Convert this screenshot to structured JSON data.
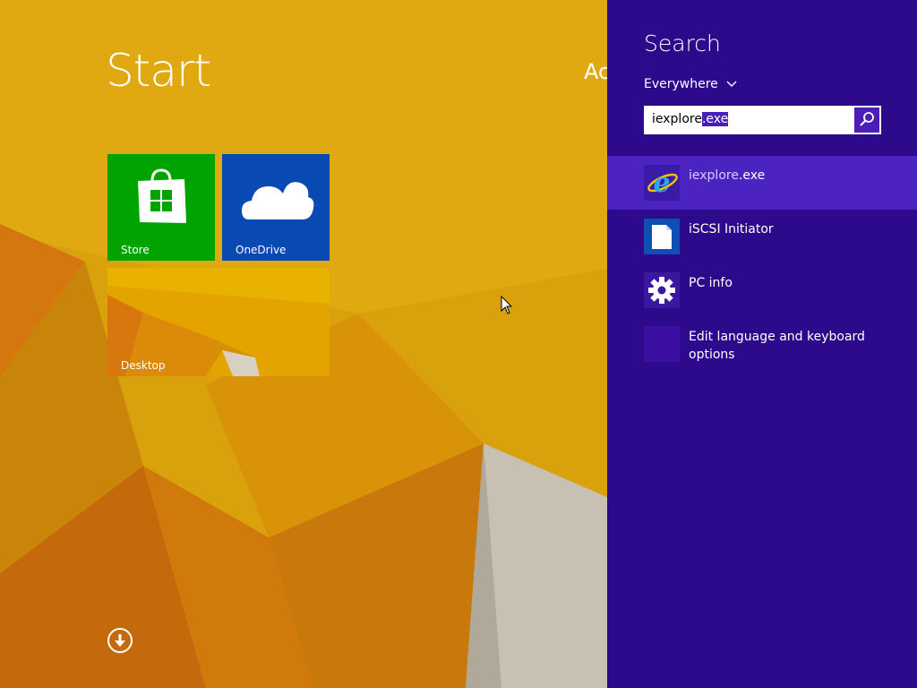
{
  "start": {
    "title": "Start",
    "account_peek": "Ac",
    "tiles": [
      {
        "label": "Store",
        "color": "#00a300",
        "icon": "store-bag-icon"
      },
      {
        "label": "OneDrive",
        "color": "#094ab2",
        "icon": "cloud-icon"
      },
      {
        "label": "Desktop",
        "color": "#e3a400",
        "icon": "desktop-wallpaper"
      }
    ],
    "apps_button_icon": "down-arrow-circle-icon"
  },
  "search": {
    "heading": "Search",
    "scope": "Everywhere",
    "query_prefix": "iexplore",
    "query_selected": ".exe",
    "go_icon": "magnifier-icon",
    "results": [
      {
        "name_prefix": "iexplore",
        "name_suffix": ".exe",
        "icon": "internet-explorer-icon",
        "selected": true
      },
      {
        "name": "iSCSI Initiator",
        "icon": "document-icon"
      },
      {
        "name": "PC info",
        "icon": "gear-icon"
      },
      {
        "name": "Edit language and keyboard options",
        "icon": "blank-settings-icon"
      }
    ]
  },
  "colors": {
    "pane_bg": "#2d0a8c",
    "accent": "#4c22c0",
    "wallpaper": "#d9a10c"
  }
}
